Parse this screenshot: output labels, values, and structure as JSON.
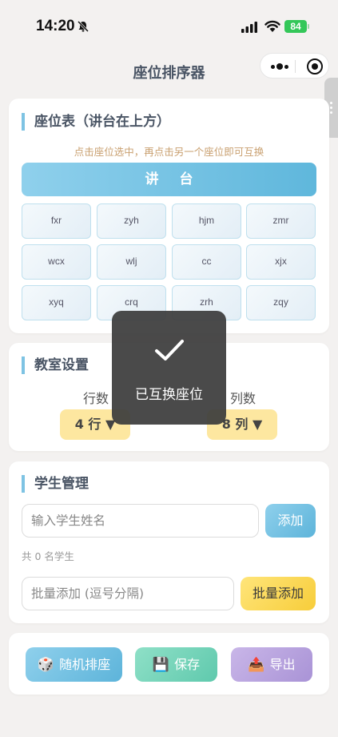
{
  "status": {
    "time": "14:20",
    "battery": "84"
  },
  "nav": {
    "title": "座位排序器"
  },
  "seat_card": {
    "title": "座位表（讲台在上方）",
    "hint": "点击座位选中，再点击另一个座位即可互换",
    "podium": "讲台",
    "seats": [
      [
        "fxr",
        "zyh",
        "hjm",
        "zmr"
      ],
      [
        "wcx",
        "wlj",
        "cc",
        "xjx"
      ],
      [
        "xyq",
        "crq",
        "zrh",
        "zqy"
      ]
    ]
  },
  "settings": {
    "title": "教室设置",
    "rows_label": "行数",
    "cols_label": "列数",
    "rows_value": "4 行 ▼",
    "cols_value": "8 列 ▼"
  },
  "students": {
    "title": "学生管理",
    "name_placeholder": "输入学生姓名",
    "add_label": "添加",
    "count_text": "共 0 名学生",
    "batch_placeholder": "批量添加 (逗号分隔)",
    "batch_label": "批量添加"
  },
  "actions": {
    "random": {
      "icon": "🎲",
      "label": "随机排座"
    },
    "save": {
      "icon": "💾",
      "label": "保存"
    },
    "export": {
      "icon": "📤",
      "label": "导出"
    }
  },
  "toast": {
    "text": "已互换座位"
  },
  "colors": {
    "accent_blue": "#5fb7dc",
    "accent_yellow": "#f7cd3a",
    "save_green": "#5fd0b5",
    "export_purple": "#b39ddb"
  }
}
